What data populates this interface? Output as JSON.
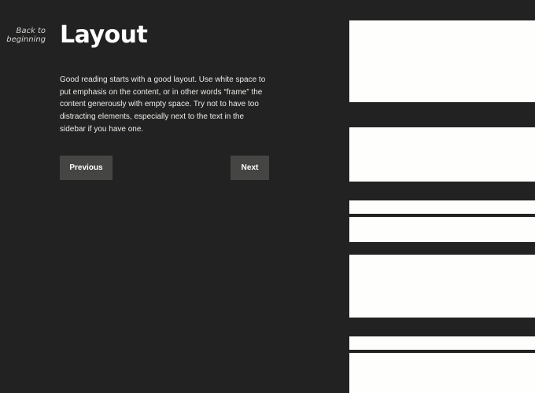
{
  "nav": {
    "back_line1": "Back to",
    "back_line2": "beginning"
  },
  "page": {
    "title": "Layout",
    "body": "Good reading starts with a good layout. Use white space to put emphasis on the content, or in other words “frame” the content generously with empty space. Try not to have too distracting elements, especially next to the text in the sidebar if you have one."
  },
  "buttons": {
    "previous": "Previous",
    "next": "Next"
  },
  "colors": {
    "background": "#212221",
    "button": "#454544",
    "sidebar_block": "#fefefc",
    "text": "#ecece8"
  }
}
